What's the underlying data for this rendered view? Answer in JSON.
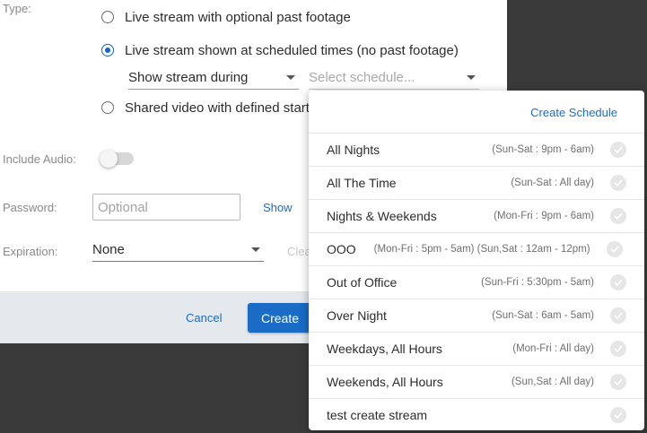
{
  "form": {
    "type_label": "Type:",
    "options": [
      {
        "label": "Live stream with optional past footage",
        "checked": false
      },
      {
        "label": "Live stream shown at scheduled times (no past footage)",
        "checked": true
      },
      {
        "label": "Shared video with defined start",
        "checked": false
      }
    ],
    "show_mode": "Show stream during",
    "schedule_placeholder": "Select schedule...",
    "include_audio_label": "Include Audio:",
    "password_label": "Password:",
    "password_placeholder": "Optional",
    "show_password": "Show",
    "expiration_label": "Expiration:",
    "expiration_value": "None",
    "clear_label": "Clea"
  },
  "footer": {
    "cancel_label": "Cancel",
    "create_label": "Create"
  },
  "dropdown": {
    "create_schedule": "Create Schedule",
    "items": [
      {
        "name": "All Nights",
        "range": "(Sun-Sat : 9pm - 6am)"
      },
      {
        "name": "All The Time",
        "range": "(Sun-Sat : All day)"
      },
      {
        "name": "Nights & Weekends",
        "range": "(Mon-Fri : 9pm - 6am)"
      },
      {
        "name": "OOO",
        "range": "(Mon-Fri : 5pm - 5am) (Sun,Sat : 12am - 12pm)"
      },
      {
        "name": "Out of Office",
        "range": "(Sun-Fri : 5:30pm - 5am)"
      },
      {
        "name": "Over Night",
        "range": "(Sun-Sat : 6am - 5am)"
      },
      {
        "name": "Weekdays, All Hours",
        "range": "(Mon-Fri : All day)"
      },
      {
        "name": "Weekends, All Hours",
        "range": "(Sun,Sat : All day)"
      },
      {
        "name": "test create stream",
        "range": ""
      }
    ]
  },
  "colors": {
    "accent": "#1a6cc6",
    "backdrop": "#3a3a3a",
    "footer": "#e5e8ed"
  }
}
